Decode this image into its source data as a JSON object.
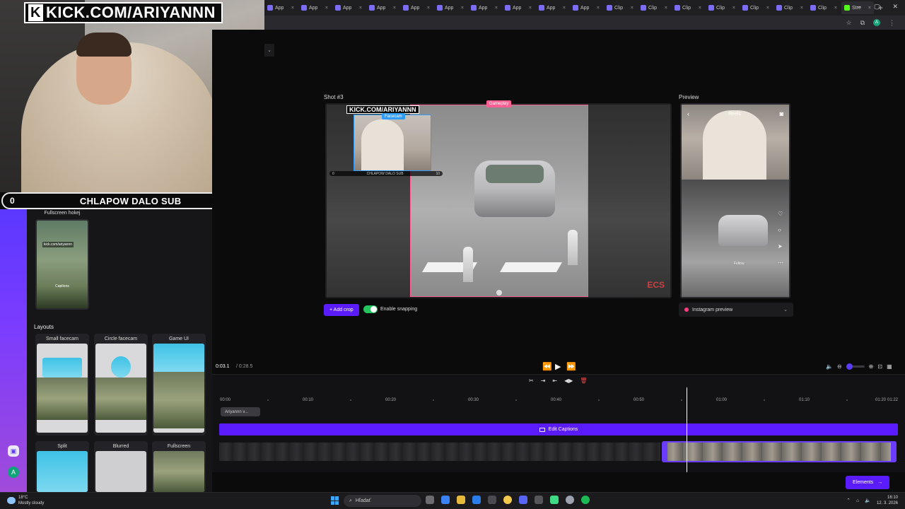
{
  "stream": {
    "kick_label": "KICK.COM/ARIYANNN",
    "sub_goal": {
      "start": "0",
      "label": "CHLAPOW DALO SUB",
      "end": "10"
    }
  },
  "browser": {
    "tabs": [
      {
        "label": "App",
        "active": false,
        "type": "app"
      },
      {
        "label": "App",
        "active": false,
        "type": "app"
      },
      {
        "label": "App",
        "active": false,
        "type": "app"
      },
      {
        "label": "App",
        "active": false,
        "type": "app"
      },
      {
        "label": "App",
        "active": false,
        "type": "app"
      },
      {
        "label": "App",
        "active": false,
        "type": "app"
      },
      {
        "label": "App",
        "active": false,
        "type": "app"
      },
      {
        "label": "App",
        "active": false,
        "type": "app"
      },
      {
        "label": "App",
        "active": false,
        "type": "app"
      },
      {
        "label": "App",
        "active": false,
        "type": "app"
      },
      {
        "label": "Clip",
        "active": false,
        "type": "app"
      },
      {
        "label": "Clip",
        "active": false,
        "type": "app"
      },
      {
        "label": "Clip",
        "active": false,
        "type": "app"
      },
      {
        "label": "Clip",
        "active": false,
        "type": "app"
      },
      {
        "label": "Clip",
        "active": false,
        "type": "app"
      },
      {
        "label": "Clip",
        "active": false,
        "type": "app"
      },
      {
        "label": "Clip",
        "active": false,
        "type": "app"
      },
      {
        "label": "Stre",
        "active": true,
        "type": "kick"
      }
    ],
    "new_tab": "+",
    "window_controls": [
      "–",
      "▢",
      "✕"
    ],
    "address_icons": [
      "☆",
      "⧉",
      "⋮"
    ],
    "avatar_letter": "A"
  },
  "left_panel": {
    "fullscreen_card": {
      "title": "Fullscreen hokej",
      "kick_text": "kick.com/ariyannn",
      "caption_text": "Captions"
    },
    "layouts_label": "Layouts",
    "layouts": [
      {
        "name": "Small facecam"
      },
      {
        "name": "Circle facecam"
      },
      {
        "name": "Game UI"
      },
      {
        "name": "Split"
      },
      {
        "name": "Blurred"
      },
      {
        "name": "Fullscreen"
      }
    ],
    "rail_user_letter": "A"
  },
  "editor": {
    "shot_label": "Shot #3",
    "preview_label": "Preview",
    "crop_tags": {
      "gameplay": "Gameplay",
      "facecam": "Facecam"
    },
    "shot_kick_text": "KICK.COM/ARIYANNN",
    "shot_subbar": {
      "start": "0",
      "label": "CHLAPOW DALO SUB",
      "end": "10"
    },
    "shot_watermark": "ECS",
    "add_crop_label": "+ Add crop",
    "snapping_label": "Enable snapping",
    "snapping_on": true,
    "preview": {
      "reels_label": "Reels",
      "follow_label": "Follow",
      "select_label": "Instagram preview"
    }
  },
  "playback": {
    "current_time": "0:03.1",
    "total_time": "0:28.5",
    "separator": "/",
    "volume_level": 0.0
  },
  "timeline": {
    "tools": [
      "✂",
      "⇥",
      "⇤",
      "◀▶",
      "🗑"
    ],
    "ruler": [
      "00:00",
      "00:10",
      "00:20",
      "00:30",
      "00:40",
      "00:50",
      "01:00",
      "01:10",
      "01:20",
      "01:22"
    ],
    "track_name": "Ariyannn v...",
    "captions_label": "Edit Captions",
    "elements_label": "Elements"
  },
  "taskbar": {
    "temperature": "18°C",
    "weather": "Mostly cloudy",
    "search_placeholder": "Hľadať",
    "time": "16:10",
    "date": "12. 3. 2026"
  }
}
